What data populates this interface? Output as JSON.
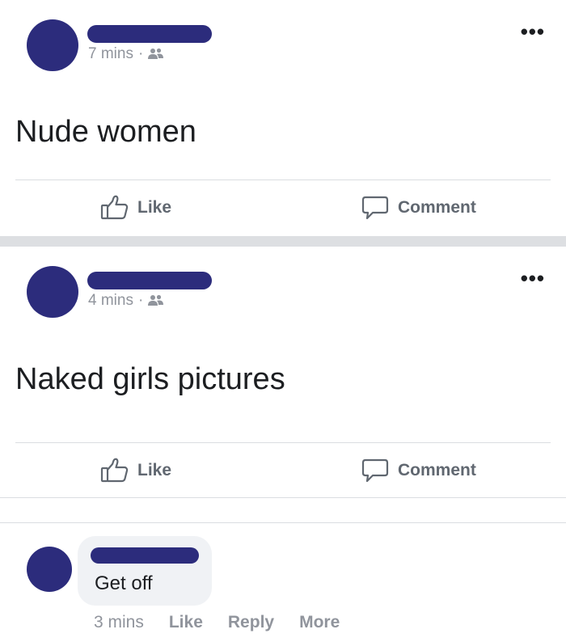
{
  "posts": [
    {
      "time": "7 mins",
      "dot": "·",
      "privacy_icon": "friends-icon",
      "more_icon": "more-horizontal-icon",
      "more_text": "•••",
      "text": "Nude women",
      "actions": {
        "like_label": "Like",
        "comment_label": "Comment"
      }
    },
    {
      "time": "4 mins",
      "dot": "·",
      "privacy_icon": "friends-icon",
      "more_icon": "more-horizontal-icon",
      "more_text": "•••",
      "text": "Naked girls pictures",
      "actions": {
        "like_label": "Like",
        "comment_label": "Comment"
      }
    }
  ],
  "comment": {
    "text": "Get off",
    "time": "3 mins",
    "like_label": "Like",
    "reply_label": "Reply",
    "more_label": "More"
  },
  "colors": {
    "avatar": "#2c2c7c",
    "redaction": "#2c2c7c",
    "meta_text": "#90949c",
    "action_text": "#606770",
    "separator": "#dddfe2"
  }
}
